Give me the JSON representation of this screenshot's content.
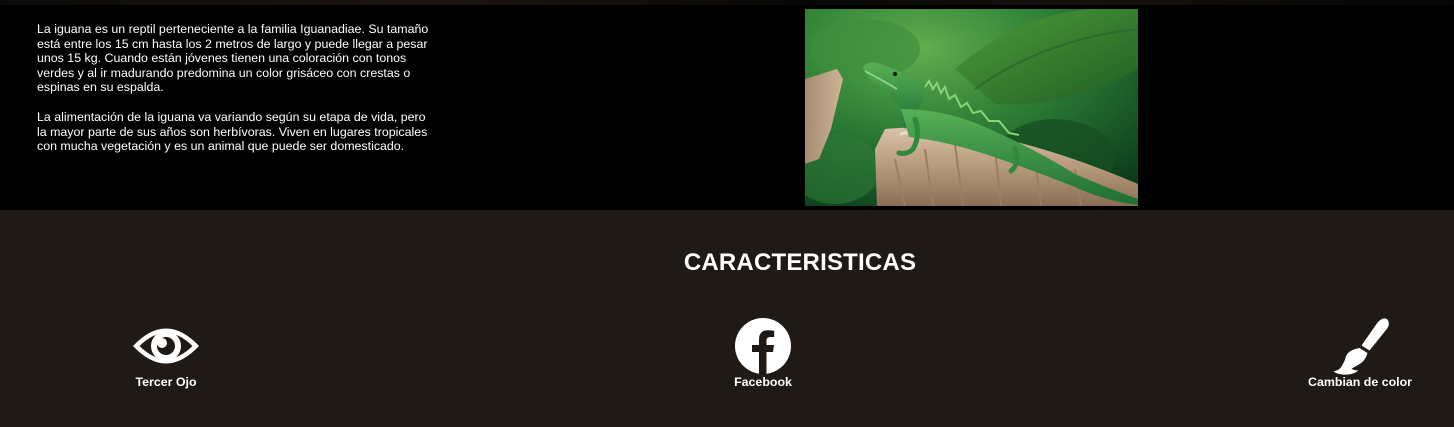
{
  "intro": {
    "paragraph_1": "La iguana es un reptil perteneciente a la familia Iguanadiae. Su tamaño está entre los 15 cm hasta los 2 metros de largo y puede llegar a pesar unos 15 kg. Cuando están jóvenes tienen una coloración con tonos verdes y al ir madurando predomina un color grisáceo con crestas o espinas en su espalda.",
    "paragraph_2": "La alimentación de la iguana va variando según su etapa de vida, pero la mayor parte de sus años son herbívoras. Viven en lugares tropicales con mucha vegetación y es un animal que puede ser domesticado."
  },
  "photo": {
    "subject": "green iguana on tree stump"
  },
  "features": {
    "title": "CARACTERISTICAS",
    "items": [
      {
        "icon": "eye-icon",
        "label": "Tercer Ojo"
      },
      {
        "icon": "facebook-icon",
        "label": "Facebook"
      },
      {
        "icon": "paintbrush-icon",
        "label": "Cambian de color"
      }
    ]
  },
  "colors": {
    "top_background": "#000000",
    "features_background": "#1f1a16",
    "text": "#ffffff"
  }
}
